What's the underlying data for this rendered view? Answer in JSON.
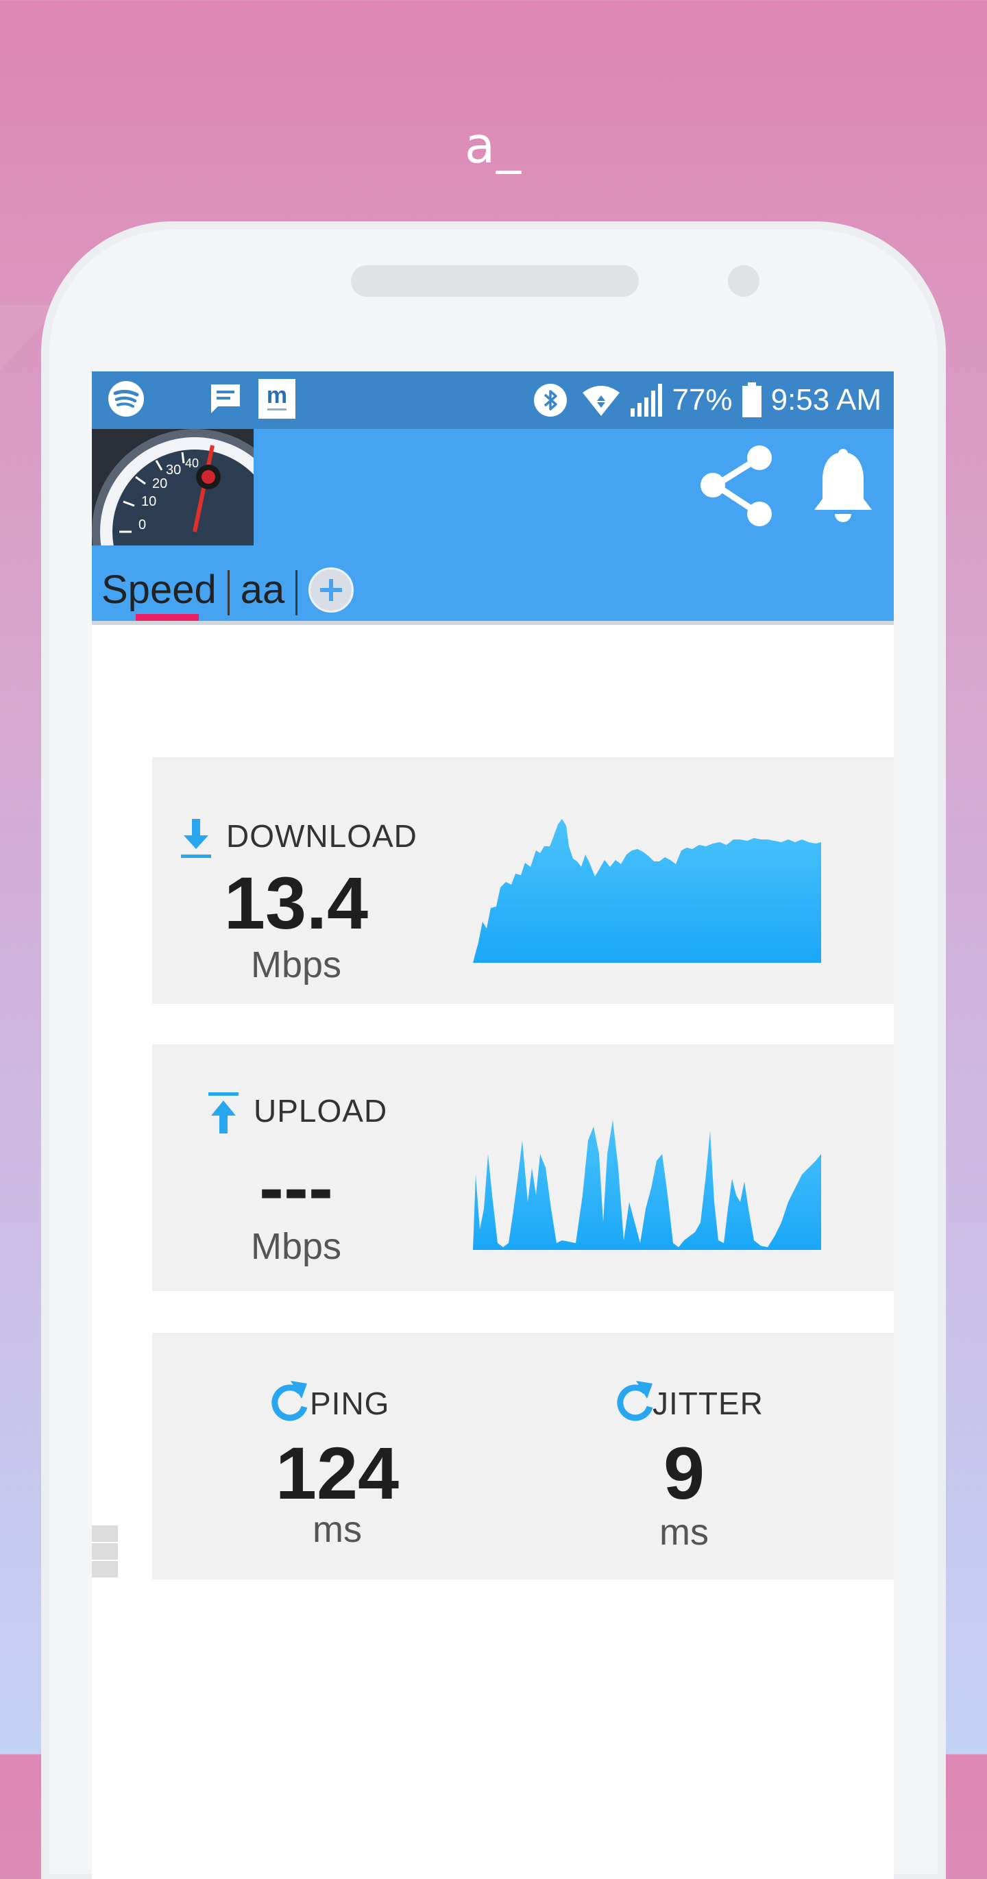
{
  "promo": {
    "title": "a_"
  },
  "status_bar": {
    "battery": "77%",
    "time": "9:53 AM",
    "icons": [
      "spotify-icon",
      "message-icon",
      "m-app-icon",
      "bluetooth-icon",
      "wifi-icon",
      "signal-icon",
      "battery-icon"
    ]
  },
  "app_bar": {
    "logo": "speedometer-logo",
    "actions": [
      "share-icon",
      "bell-icon"
    ],
    "tabs": [
      {
        "label": "Speed",
        "selected": true
      },
      {
        "label": "aa",
        "selected": false
      }
    ],
    "indicator_color": "#e91e63"
  },
  "download": {
    "label": "DOWNLOAD",
    "value": "13.4",
    "unit": "Mbps",
    "icon": "download-icon"
  },
  "upload": {
    "label": "UPLOAD",
    "value": "---",
    "unit": "Mbps",
    "icon": "upload-icon"
  },
  "ping": {
    "label": "PING",
    "value": "124",
    "unit": "ms",
    "icon": "refresh-icon"
  },
  "jitter": {
    "label": "JITTER",
    "value": "9",
    "unit": "ms",
    "icon": "refresh-icon"
  },
  "colors": {
    "accent": "#45a3f2",
    "status_bar": "#3a86c9",
    "graph": "#29b0fa"
  }
}
